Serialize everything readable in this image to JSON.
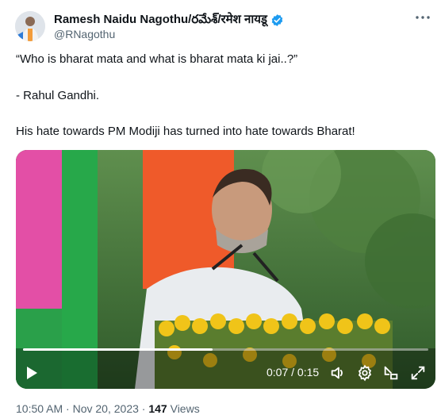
{
  "author": {
    "name": "Ramesh Naidu Nagothu/రమేశ్/रमेश नायडू",
    "handle": "@RNagothu",
    "verified": true
  },
  "tweet": {
    "line1": "“Who is bharat mata and what is bharat mata ki jai..?”",
    "line2": "- Rahul Gandhi.",
    "line3": "His hate towards PM Modiji has turned into hate towards Bharat!"
  },
  "video": {
    "current_time": "0:07",
    "duration": "0:15",
    "time_display": "0:07 / 0:15",
    "progress_fraction": 0.467
  },
  "footer": {
    "time": "10:50 AM",
    "separator": "·",
    "date": "Nov 20, 2023",
    "views_count": "147",
    "views_label": "Views"
  },
  "icons": {
    "more": "more-options-icon",
    "verified": "verified-badge-icon",
    "play": "play-icon",
    "volume": "volume-icon",
    "settings": "settings-gear-icon",
    "pip": "picture-in-picture-icon",
    "fullscreen": "fullscreen-icon"
  },
  "colors": {
    "verified_blue": "#1d9bf0",
    "secondary_text": "#536471",
    "primary_text": "#0f1419"
  }
}
